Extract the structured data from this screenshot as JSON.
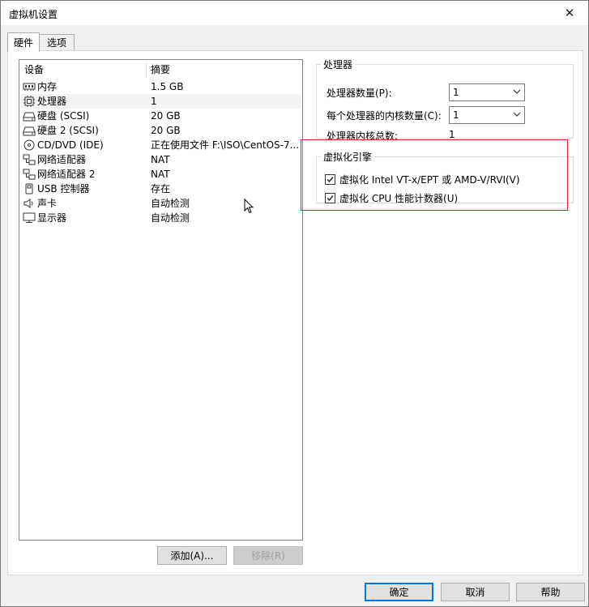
{
  "window": {
    "title": "虚拟机设置",
    "close_glyph": "✕"
  },
  "tabs": [
    {
      "label": "硬件",
      "active": true
    },
    {
      "label": "选项",
      "active": false
    }
  ],
  "device_list": {
    "headers": {
      "device": "设备",
      "summary": "摘要"
    },
    "rows": [
      {
        "icon": "memory-icon",
        "name": "内存",
        "summary": "1.5 GB"
      },
      {
        "icon": "processor-icon",
        "name": "处理器",
        "summary": "1",
        "selected": true
      },
      {
        "icon": "hard-disk-icon",
        "name": "硬盘 (SCSI)",
        "summary": "20 GB"
      },
      {
        "icon": "hard-disk-icon",
        "name": "硬盘 2 (SCSI)",
        "summary": "20 GB"
      },
      {
        "icon": "cd-dvd-icon",
        "name": "CD/DVD (IDE)",
        "summary": "正在使用文件 F:\\ISO\\CentOS-7..."
      },
      {
        "icon": "network-adapter-icon",
        "name": "网络适配器",
        "summary": "NAT"
      },
      {
        "icon": "network-adapter-icon",
        "name": "网络适配器 2",
        "summary": "NAT"
      },
      {
        "icon": "usb-icon",
        "name": "USB 控制器",
        "summary": "存在"
      },
      {
        "icon": "sound-card-icon",
        "name": "声卡",
        "summary": "自动检测"
      },
      {
        "icon": "display-icon",
        "name": "显示器",
        "summary": "自动检测"
      }
    ]
  },
  "list_buttons": {
    "add": "添加(A)...",
    "remove": "移除(R)"
  },
  "processor_group": {
    "title": "处理器",
    "count_label": "处理器数量(P):",
    "count_value": "1",
    "cores_label": "每个处理器的内核数量(C):",
    "cores_value": "1",
    "total_label": "处理器内核总数:",
    "total_value": "1"
  },
  "virtualization_group": {
    "title": "虚拟化引擎",
    "vtx_label": "虚拟化 Intel VT-x/EPT 或 AMD-V/RVI(V)",
    "vtx_checked": true,
    "cpu_counters_label": "虚拟化 CPU 性能计数器(U)",
    "cpu_counters_checked": true
  },
  "dialog_buttons": {
    "ok": "确定",
    "cancel": "取消",
    "help": "帮助"
  },
  "colors": {
    "highlight_border": "#e02020",
    "default_button_border": "#0078d7"
  }
}
